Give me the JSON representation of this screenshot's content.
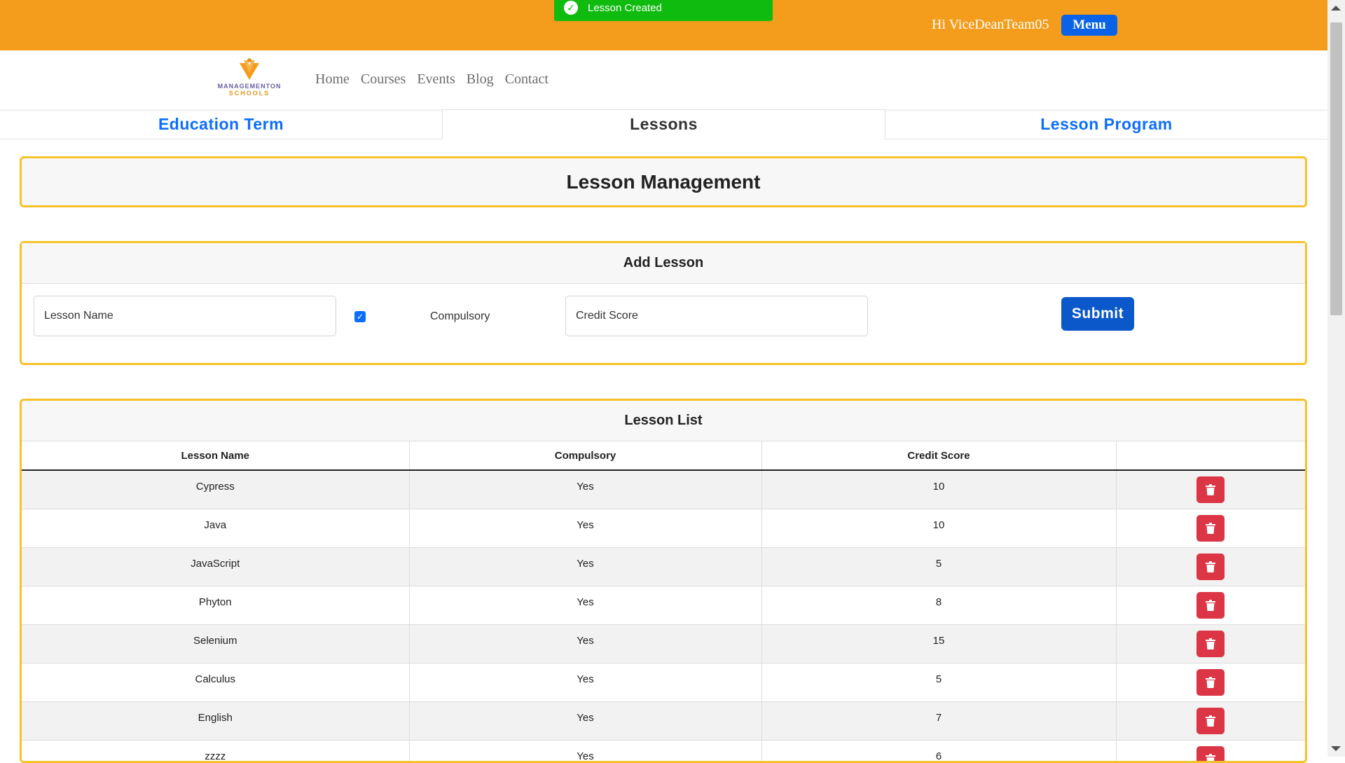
{
  "toast": {
    "message": "Lesson Created"
  },
  "header": {
    "greeting": "Hi ViceDeanTeam05",
    "menu_label": "Menu"
  },
  "logo": {
    "line1": "MANAGEMENTON",
    "line2": "SCHOOLS"
  },
  "nav": {
    "links": [
      "Home",
      "Courses",
      "Events",
      "Blog",
      "Contact"
    ]
  },
  "tabs": [
    {
      "label": "Education Term",
      "active": false
    },
    {
      "label": "Lessons",
      "active": true
    },
    {
      "label": "Lesson Program",
      "active": false
    }
  ],
  "page_title": "Lesson Management",
  "add_lesson": {
    "title": "Add Lesson",
    "lesson_name_placeholder": "Lesson Name",
    "compulsory_label": "Compulsory",
    "compulsory_checked": true,
    "credit_score_placeholder": "Credit Score",
    "submit_label": "Submit"
  },
  "lesson_list": {
    "title": "Lesson List",
    "columns": [
      "Lesson Name",
      "Compulsory",
      "Credit Score",
      ""
    ],
    "rows": [
      {
        "name": "Cypress",
        "compulsory": "Yes",
        "credit": "10"
      },
      {
        "name": "Java",
        "compulsory": "Yes",
        "credit": "10"
      },
      {
        "name": "JavaScript",
        "compulsory": "Yes",
        "credit": "5"
      },
      {
        "name": "Phyton",
        "compulsory": "Yes",
        "credit": "8"
      },
      {
        "name": "Selenium",
        "compulsory": "Yes",
        "credit": "15"
      },
      {
        "name": "Calculus",
        "compulsory": "Yes",
        "credit": "5"
      },
      {
        "name": "English",
        "compulsory": "Yes",
        "credit": "7"
      },
      {
        "name": "zzzz",
        "compulsory": "Yes",
        "credit": "6"
      }
    ]
  },
  "colors": {
    "topbar": "#f49d1c",
    "accent": "#0d6efd",
    "panel_border": "#f6c22a",
    "delete": "#dc3545",
    "toast": "#0ebb0e"
  }
}
